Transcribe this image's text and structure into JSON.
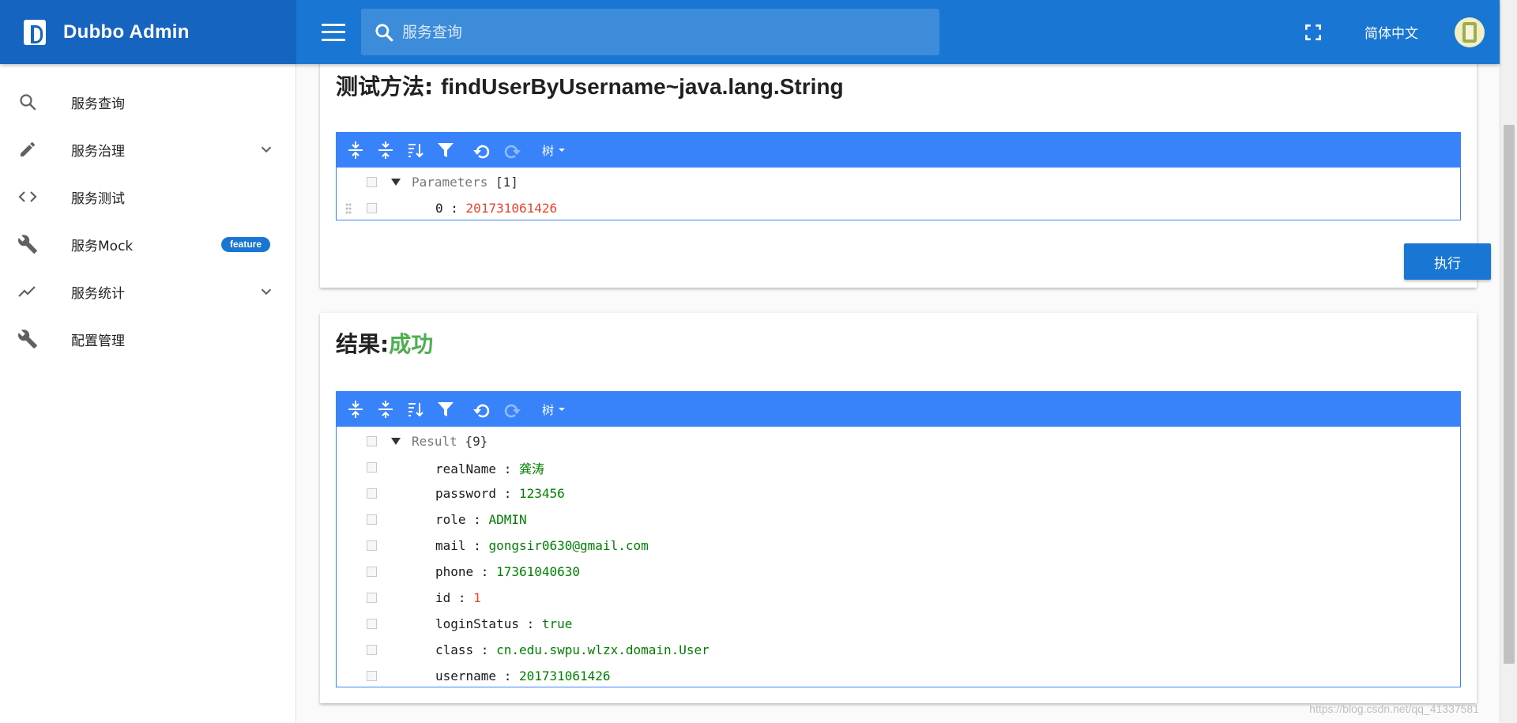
{
  "app": {
    "title": "Dubbo Admin",
    "search_placeholder": "服务查询",
    "language": "简体中文"
  },
  "sidebar": {
    "items": [
      {
        "label": "服务查询",
        "icon": "search-icon"
      },
      {
        "label": "服务治理",
        "icon": "pencil-icon",
        "expandable": true
      },
      {
        "label": "服务测试",
        "icon": "code-icon"
      },
      {
        "label": "服务Mock",
        "icon": "wrench-icon",
        "badge": "feature"
      },
      {
        "label": "服务统计",
        "icon": "trending-icon",
        "expandable": true
      },
      {
        "label": "配置管理",
        "icon": "wrench-icon"
      }
    ]
  },
  "test_card": {
    "title_prefix": "测试方法: ",
    "method": "findUserByUsername~java.lang.String",
    "mode_label": "树",
    "root_field": "Parameters",
    "root_count": "[1]",
    "params": [
      {
        "key": "0",
        "value": "201731061426",
        "type": "number"
      }
    ],
    "execute_label": "执行"
  },
  "result_card": {
    "title_prefix": "结果:",
    "status": "成功",
    "mode_label": "树",
    "root_field": "Result",
    "root_count": "{9}",
    "fields": [
      {
        "key": "realName",
        "value": "龚涛",
        "type": "string"
      },
      {
        "key": "password",
        "value": "123456",
        "type": "string"
      },
      {
        "key": "role",
        "value": "ADMIN",
        "type": "string"
      },
      {
        "key": "mail",
        "value": "gongsir0630@gmail.com",
        "type": "string"
      },
      {
        "key": "phone",
        "value": "17361040630",
        "type": "string"
      },
      {
        "key": "id",
        "value": "1",
        "type": "number"
      },
      {
        "key": "loginStatus",
        "value": "true",
        "type": "boolean"
      },
      {
        "key": "class",
        "value": "cn.edu.swpu.wlzx.domain.User",
        "type": "string"
      },
      {
        "key": "username",
        "value": "201731061426",
        "type": "string"
      }
    ]
  },
  "watermark": "https://blog.csdn.net/qq_41337581",
  "colors": {
    "appbar": "#1976d2",
    "brand": "#1565c0",
    "editor_toolbar": "#3883fa",
    "success": "#4caf50",
    "number": "#ee422e",
    "string": "#008000"
  }
}
